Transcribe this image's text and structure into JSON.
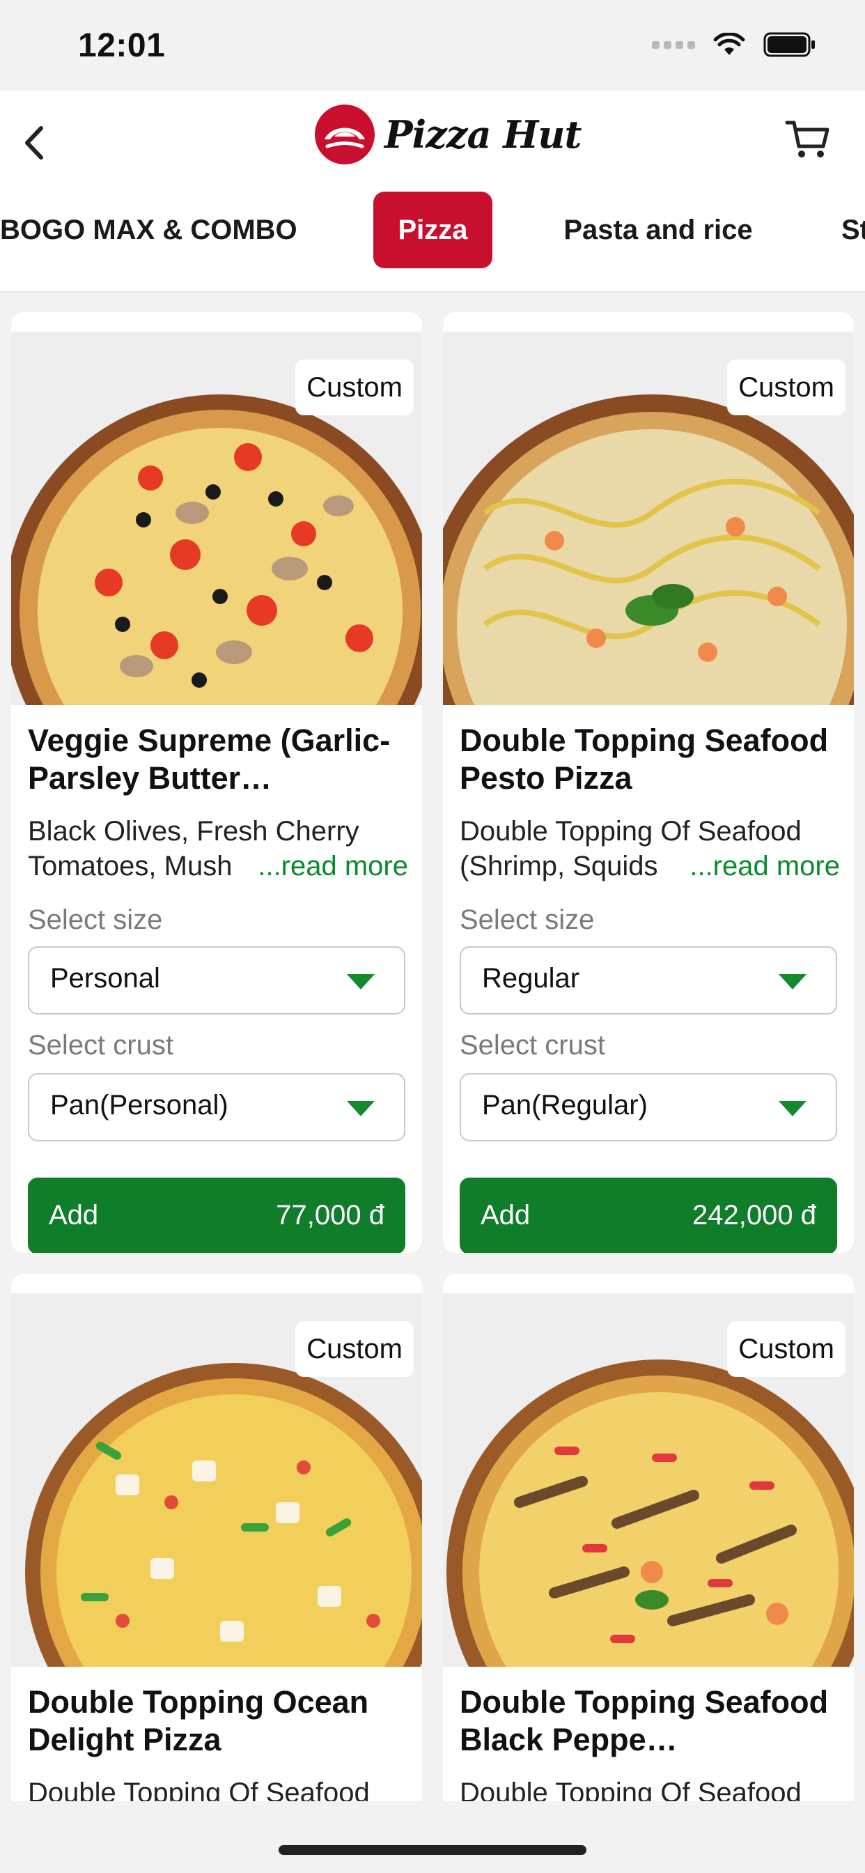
{
  "status_bar": {
    "time": "12:01"
  },
  "header": {
    "brand_name": "Pizza Hut",
    "logo_icon": "pizza-hut-roof-logo",
    "back_icon": "chevron-left-icon",
    "cart_icon": "cart-icon"
  },
  "tabs": [
    {
      "label": "BOGO MAX & COMBO",
      "active": false
    },
    {
      "label": "Pizza",
      "active": true
    },
    {
      "label": "Pasta and rice",
      "active": false
    },
    {
      "label": "St",
      "active": false
    }
  ],
  "colors": {
    "brand_red": "#c8102e",
    "action_green": "#0f7d2a",
    "link_green": "#0a8a2a"
  },
  "products": [
    {
      "badge": "Custom",
      "title": "Veggie Supreme (Garlic-Parsley Butter…",
      "description": "Black Olives, Fresh Cherry Tomatoes, Mush",
      "read_more": "...read more",
      "size_label": "Select size",
      "size_value": "Personal",
      "crust_label": "Select crust",
      "crust_value": "Pan(Personal)",
      "add_label": "Add",
      "price": "77,000 đ",
      "photo": "veggie-pizza"
    },
    {
      "badge": "Custom",
      "title": "Double Topping Seafood Pesto Pizza",
      "description": "Double Topping Of Seafood (Shrimp, Squids",
      "read_more": "...read more",
      "size_label": "Select size",
      "size_value": "Regular",
      "crust_label": "Select crust",
      "crust_value": "Pan(Regular)",
      "add_label": "Add",
      "price": "242,000 đ",
      "photo": "seafood-pesto-pizza"
    },
    {
      "badge": "Custom",
      "title": "Double Topping Ocean Delight Pizza",
      "description": "Double Topping Of Seafood",
      "photo": "ocean-delight-pizza"
    },
    {
      "badge": "Custom",
      "title": "Double Topping Seafood Black Peppe…",
      "description": "Double Topping Of Seafood",
      "photo": "seafood-black-pepper-pizza"
    }
  ]
}
